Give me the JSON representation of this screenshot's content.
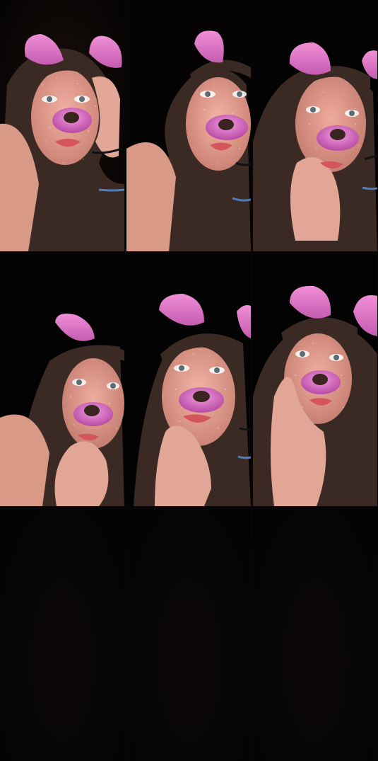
{
  "gallery": {
    "tiles": [
      {
        "kind": "photo",
        "filter": "pink-puppy-ears-glitter-filter",
        "pose": "hand-on-temple"
      },
      {
        "kind": "photo",
        "filter": "pink-puppy-ears-glitter-filter",
        "pose": "looking-at-camera"
      },
      {
        "kind": "photo",
        "filter": "pink-puppy-ears-glitter-filter",
        "pose": "hand-on-lip"
      },
      {
        "kind": "photo",
        "filter": "pink-puppy-ears-glitter-filter",
        "pose": "hand-on-chin-tilted"
      },
      {
        "kind": "photo",
        "filter": "pink-puppy-ears-glitter-filter",
        "pose": "chin-in-hand"
      },
      {
        "kind": "photo",
        "filter": "pink-puppy-ears-glitter-filter",
        "pose": "cheek-in-hand"
      },
      {
        "kind": "empty"
      },
      {
        "kind": "empty"
      },
      {
        "kind": "empty"
      }
    ]
  },
  "colors": {
    "background": "#000000",
    "ear_pink": "#e77ac9",
    "nose_pink": "#d565c0",
    "skin": "#e9a395",
    "hair": "#3b2a24"
  }
}
